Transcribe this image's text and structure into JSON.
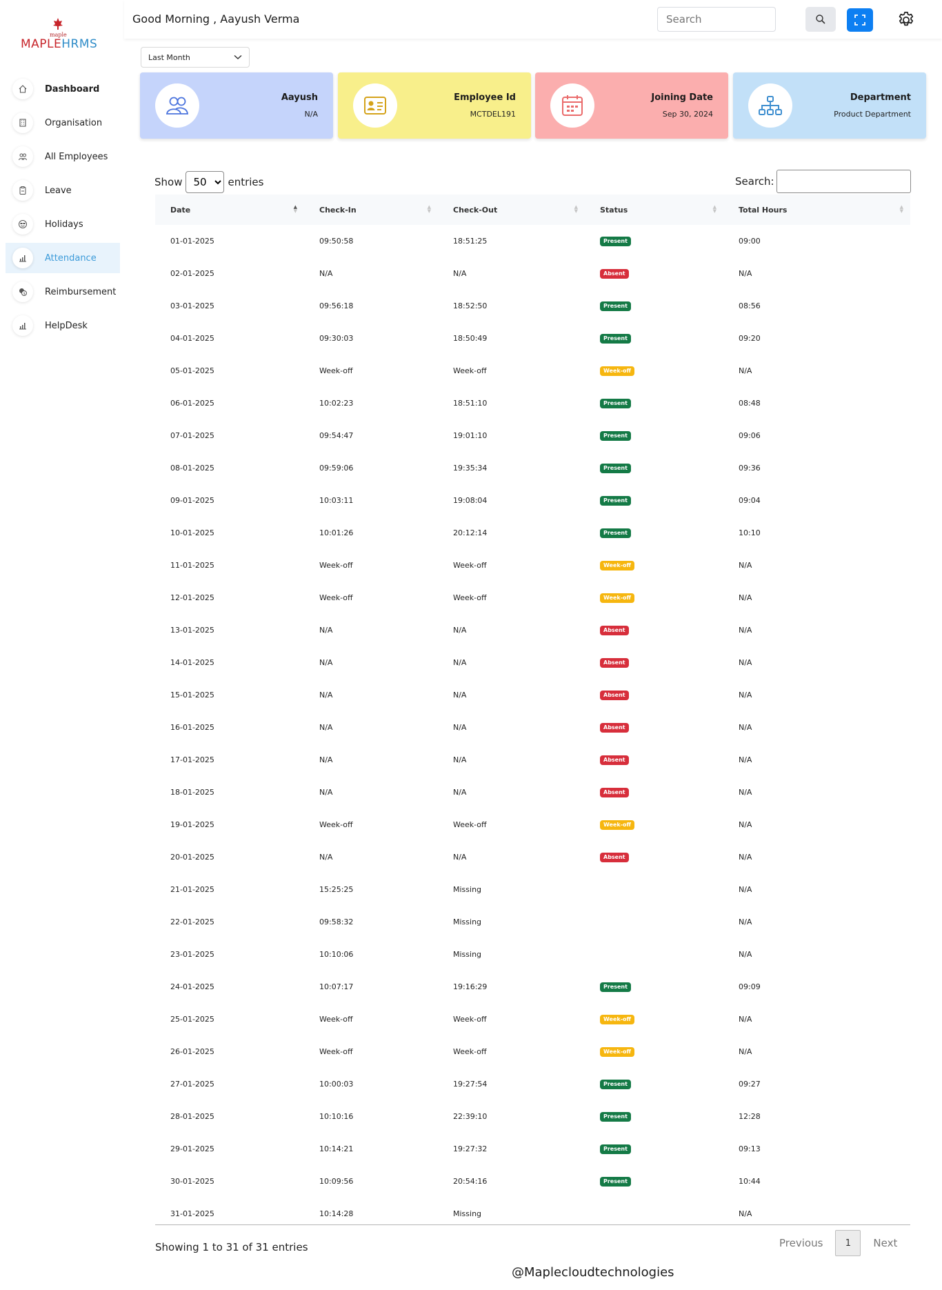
{
  "brand": {
    "logo_small": "maple",
    "logo_text_a": "MAPLE",
    "logo_text_b": "HRMS"
  },
  "sidebar": {
    "items": [
      {
        "label": "Dashboard",
        "icon": "home-icon"
      },
      {
        "label": "Organisation",
        "icon": "building-icon"
      },
      {
        "label": "All Employees",
        "icon": "users-icon"
      },
      {
        "label": "Leave",
        "icon": "clipboard-icon"
      },
      {
        "label": "Holidays",
        "icon": "smile-icon"
      },
      {
        "label": "Attendance",
        "icon": "chart-icon",
        "active": true
      },
      {
        "label": "Reimbursement",
        "icon": "coins-icon"
      },
      {
        "label": "HelpDesk",
        "icon": "chart-icon"
      }
    ]
  },
  "header": {
    "greeting": "Good Morning , Aayush Verma",
    "search_placeholder": "Search"
  },
  "filter": {
    "selected": "Last Month"
  },
  "cards": [
    {
      "title": "Aayush",
      "value": "N/A",
      "icon": "users-icon",
      "color": "#c5d4fb"
    },
    {
      "title": "Employee Id",
      "value": "MCTDEL191",
      "icon": "id-card-icon",
      "color": "#f8ef8b"
    },
    {
      "title": "Joining Date",
      "value": "Sep 30, 2024",
      "icon": "calendar-icon",
      "color": "#fbaeae"
    },
    {
      "title": "Department",
      "value": "Product Department",
      "icon": "org-chart-icon",
      "color": "#c2e0f8"
    }
  ],
  "table_controls": {
    "show_label": "Show",
    "entries_value": "50",
    "entries_label": "entries",
    "search_label": "Search:"
  },
  "table": {
    "columns": [
      "Date",
      "Check-In",
      "Check-Out",
      "Status",
      "Total Hours"
    ],
    "rows": [
      [
        "01-01-2025",
        "09:50:58",
        "18:51:25",
        "Present",
        "09:00"
      ],
      [
        "02-01-2025",
        "N/A",
        "N/A",
        "Absent",
        "N/A"
      ],
      [
        "03-01-2025",
        "09:56:18",
        "18:52:50",
        "Present",
        "08:56"
      ],
      [
        "04-01-2025",
        "09:30:03",
        "18:50:49",
        "Present",
        "09:20"
      ],
      [
        "05-01-2025",
        "Week-off",
        "Week-off",
        "Week-off",
        "N/A"
      ],
      [
        "06-01-2025",
        "10:02:23",
        "18:51:10",
        "Present",
        "08:48"
      ],
      [
        "07-01-2025",
        "09:54:47",
        "19:01:10",
        "Present",
        "09:06"
      ],
      [
        "08-01-2025",
        "09:59:06",
        "19:35:34",
        "Present",
        "09:36"
      ],
      [
        "09-01-2025",
        "10:03:11",
        "19:08:04",
        "Present",
        "09:04"
      ],
      [
        "10-01-2025",
        "10:01:26",
        "20:12:14",
        "Present",
        "10:10"
      ],
      [
        "11-01-2025",
        "Week-off",
        "Week-off",
        "Week-off",
        "N/A"
      ],
      [
        "12-01-2025",
        "Week-off",
        "Week-off",
        "Week-off",
        "N/A"
      ],
      [
        "13-01-2025",
        "N/A",
        "N/A",
        "Absent",
        "N/A"
      ],
      [
        "14-01-2025",
        "N/A",
        "N/A",
        "Absent",
        "N/A"
      ],
      [
        "15-01-2025",
        "N/A",
        "N/A",
        "Absent",
        "N/A"
      ],
      [
        "16-01-2025",
        "N/A",
        "N/A",
        "Absent",
        "N/A"
      ],
      [
        "17-01-2025",
        "N/A",
        "N/A",
        "Absent",
        "N/A"
      ],
      [
        "18-01-2025",
        "N/A",
        "N/A",
        "Absent",
        "N/A"
      ],
      [
        "19-01-2025",
        "Week-off",
        "Week-off",
        "Week-off",
        "N/A"
      ],
      [
        "20-01-2025",
        "N/A",
        "N/A",
        "Absent",
        "N/A"
      ],
      [
        "21-01-2025",
        "15:25:25",
        "Missing",
        "",
        "N/A"
      ],
      [
        "22-01-2025",
        "09:58:32",
        "Missing",
        "",
        "N/A"
      ],
      [
        "23-01-2025",
        "10:10:06",
        "Missing",
        "",
        "N/A"
      ],
      [
        "24-01-2025",
        "10:07:17",
        "19:16:29",
        "Present",
        "09:09"
      ],
      [
        "25-01-2025",
        "Week-off",
        "Week-off",
        "Week-off",
        "N/A"
      ],
      [
        "26-01-2025",
        "Week-off",
        "Week-off",
        "Week-off",
        "N/A"
      ],
      [
        "27-01-2025",
        "10:00:03",
        "19:27:54",
        "Present",
        "09:27"
      ],
      [
        "28-01-2025",
        "10:10:16",
        "22:39:10",
        "Present",
        "12:28"
      ],
      [
        "29-01-2025",
        "10:14:21",
        "19:27:32",
        "Present",
        "09:13"
      ],
      [
        "30-01-2025",
        "10:09:56",
        "20:54:16",
        "Present",
        "10:44"
      ],
      [
        "31-01-2025",
        "10:14:28",
        "Missing",
        "",
        "N/A"
      ]
    ]
  },
  "pagination": {
    "info": "Showing 1 to 31 of 31 entries",
    "previous": "Previous",
    "page": "1",
    "next": "Next"
  },
  "footer": {
    "text": "@Maplecloudtechnologies"
  },
  "colors": {
    "accent": "#0d7ff2",
    "present": "#147a46",
    "absent": "#d72e3b",
    "weekoff": "#f6b60f"
  }
}
